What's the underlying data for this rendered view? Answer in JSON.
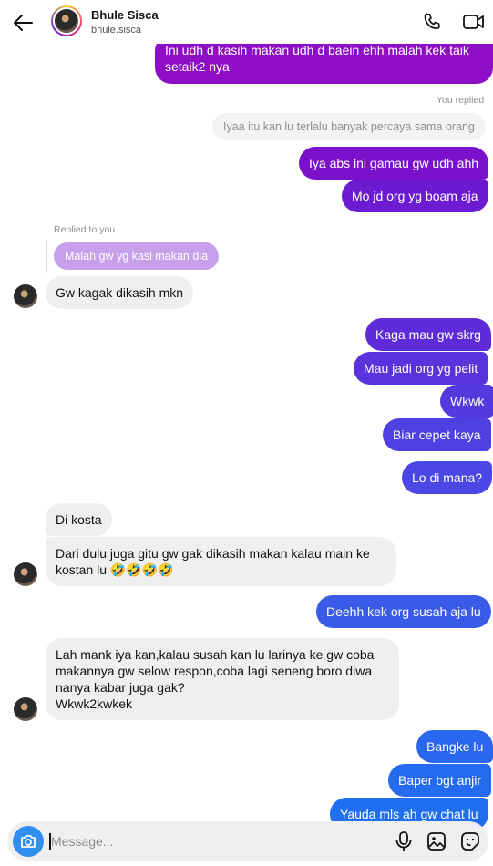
{
  "header": {
    "name": "Bhule Sisca",
    "username": "bhule.sisca"
  },
  "labels": {
    "you_replied": "You replied",
    "replied_to_you": "Replied to you"
  },
  "messages": {
    "m0": "Ini udh d kasih makan udh d baein ehh malah kek taik",
    "m0b": "setaik2 nya",
    "quote_out": "Iyaa itu kan lu terlalu banyak percaya sama orang",
    "m1": "Iya abs ini gamau gw udh ahh",
    "m2": "Mo jd org yg boam aja",
    "quote_in": "Malah gw yg kasi makan dia",
    "m3": "Gw kagak dikasih mkn",
    "m4": "Kaga mau gw skrg",
    "m5": "Mau jadi org yg pelit",
    "m6": "Wkwk",
    "m7": "Biar cepet kaya",
    "m8": "Lo di mana?",
    "m9": "Di kosta",
    "m10a": "Dari dulu juga gitu gw gak dikasih makan kalau main ke",
    "m10b": "kostan lu 🤣🤣🤣🤣",
    "m11": "Deehh kek org susah aja lu",
    "m12a": "Lah mank iya kan,kalau susah kan lu larinya ke gw coba",
    "m12b": "makannya gw selow respon,coba lagi seneng boro diwa",
    "m12c": "nanya kabar juga gak?",
    "m12d": "Wkwk2kwkek",
    "m13": "Bangke lu",
    "m14": "Baper bgt anjir",
    "m15": "Yauda mls ah gw chat lu"
  },
  "composer": {
    "placeholder": "Message..."
  },
  "colors": {
    "purple": "#8d0ec4",
    "violet": "#6c1bd3",
    "indigo": "#5a35de",
    "blue_violet": "#4e45e3",
    "blue": "#3a5be8",
    "bright_blue": "#1f6ff0",
    "incoming": "#efefef",
    "camera": "#2f8ff0"
  },
  "icons": [
    "back-arrow-icon",
    "phone-icon",
    "video-camera-icon",
    "camera-icon",
    "microphone-icon",
    "gallery-icon",
    "sticker-icon"
  ]
}
